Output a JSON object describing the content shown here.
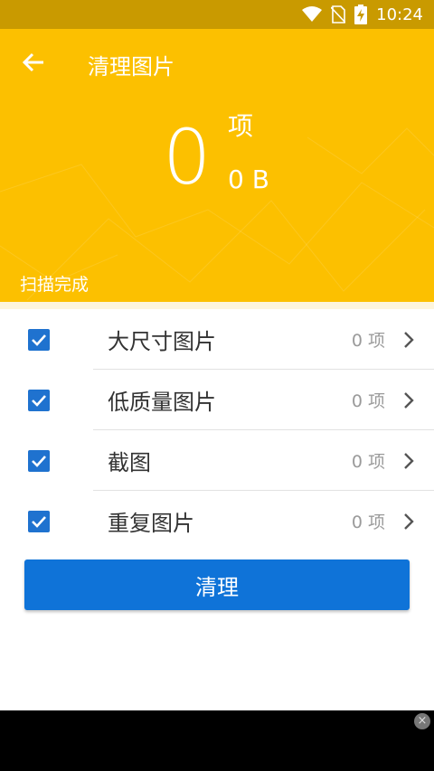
{
  "status_bar": {
    "time": "10:24",
    "icons": [
      "wifi-icon",
      "no-sim-icon",
      "battery-charging-icon"
    ]
  },
  "header": {
    "title": "清理图片",
    "count": "0",
    "count_unit": "项",
    "size": "0 B",
    "scan_status": "扫描完成",
    "color": "#fcc000"
  },
  "list": {
    "items": [
      {
        "label": "大尺寸图片",
        "count": "0 项",
        "checked": true
      },
      {
        "label": "低质量图片",
        "count": "0 项",
        "checked": true
      },
      {
        "label": "截图",
        "count": "0 项",
        "checked": true
      },
      {
        "label": "重复图片",
        "count": "0 项",
        "checked": true
      }
    ]
  },
  "actions": {
    "clean_label": "清理"
  },
  "ad": {
    "close_label": "×"
  }
}
